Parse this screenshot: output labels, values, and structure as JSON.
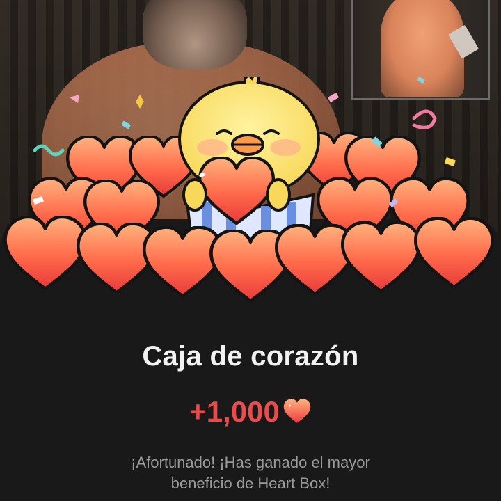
{
  "reward": {
    "title": "Caja de corazón",
    "amount": "+1,000",
    "description_line1": "¡Afortunado! ¡Has ganado el mayor",
    "description_line2": "beneficio de Heart Box!"
  },
  "icons": {
    "currency": "heart-icon",
    "mascot": "chick-mascot-icon"
  },
  "colors": {
    "accent": "#ef4a4a",
    "panel": "#191919",
    "title": "#f2f2f2",
    "description": "#9a9a9a",
    "heart_light": "#ffa77a",
    "heart_dark": "#ee3c3c"
  }
}
